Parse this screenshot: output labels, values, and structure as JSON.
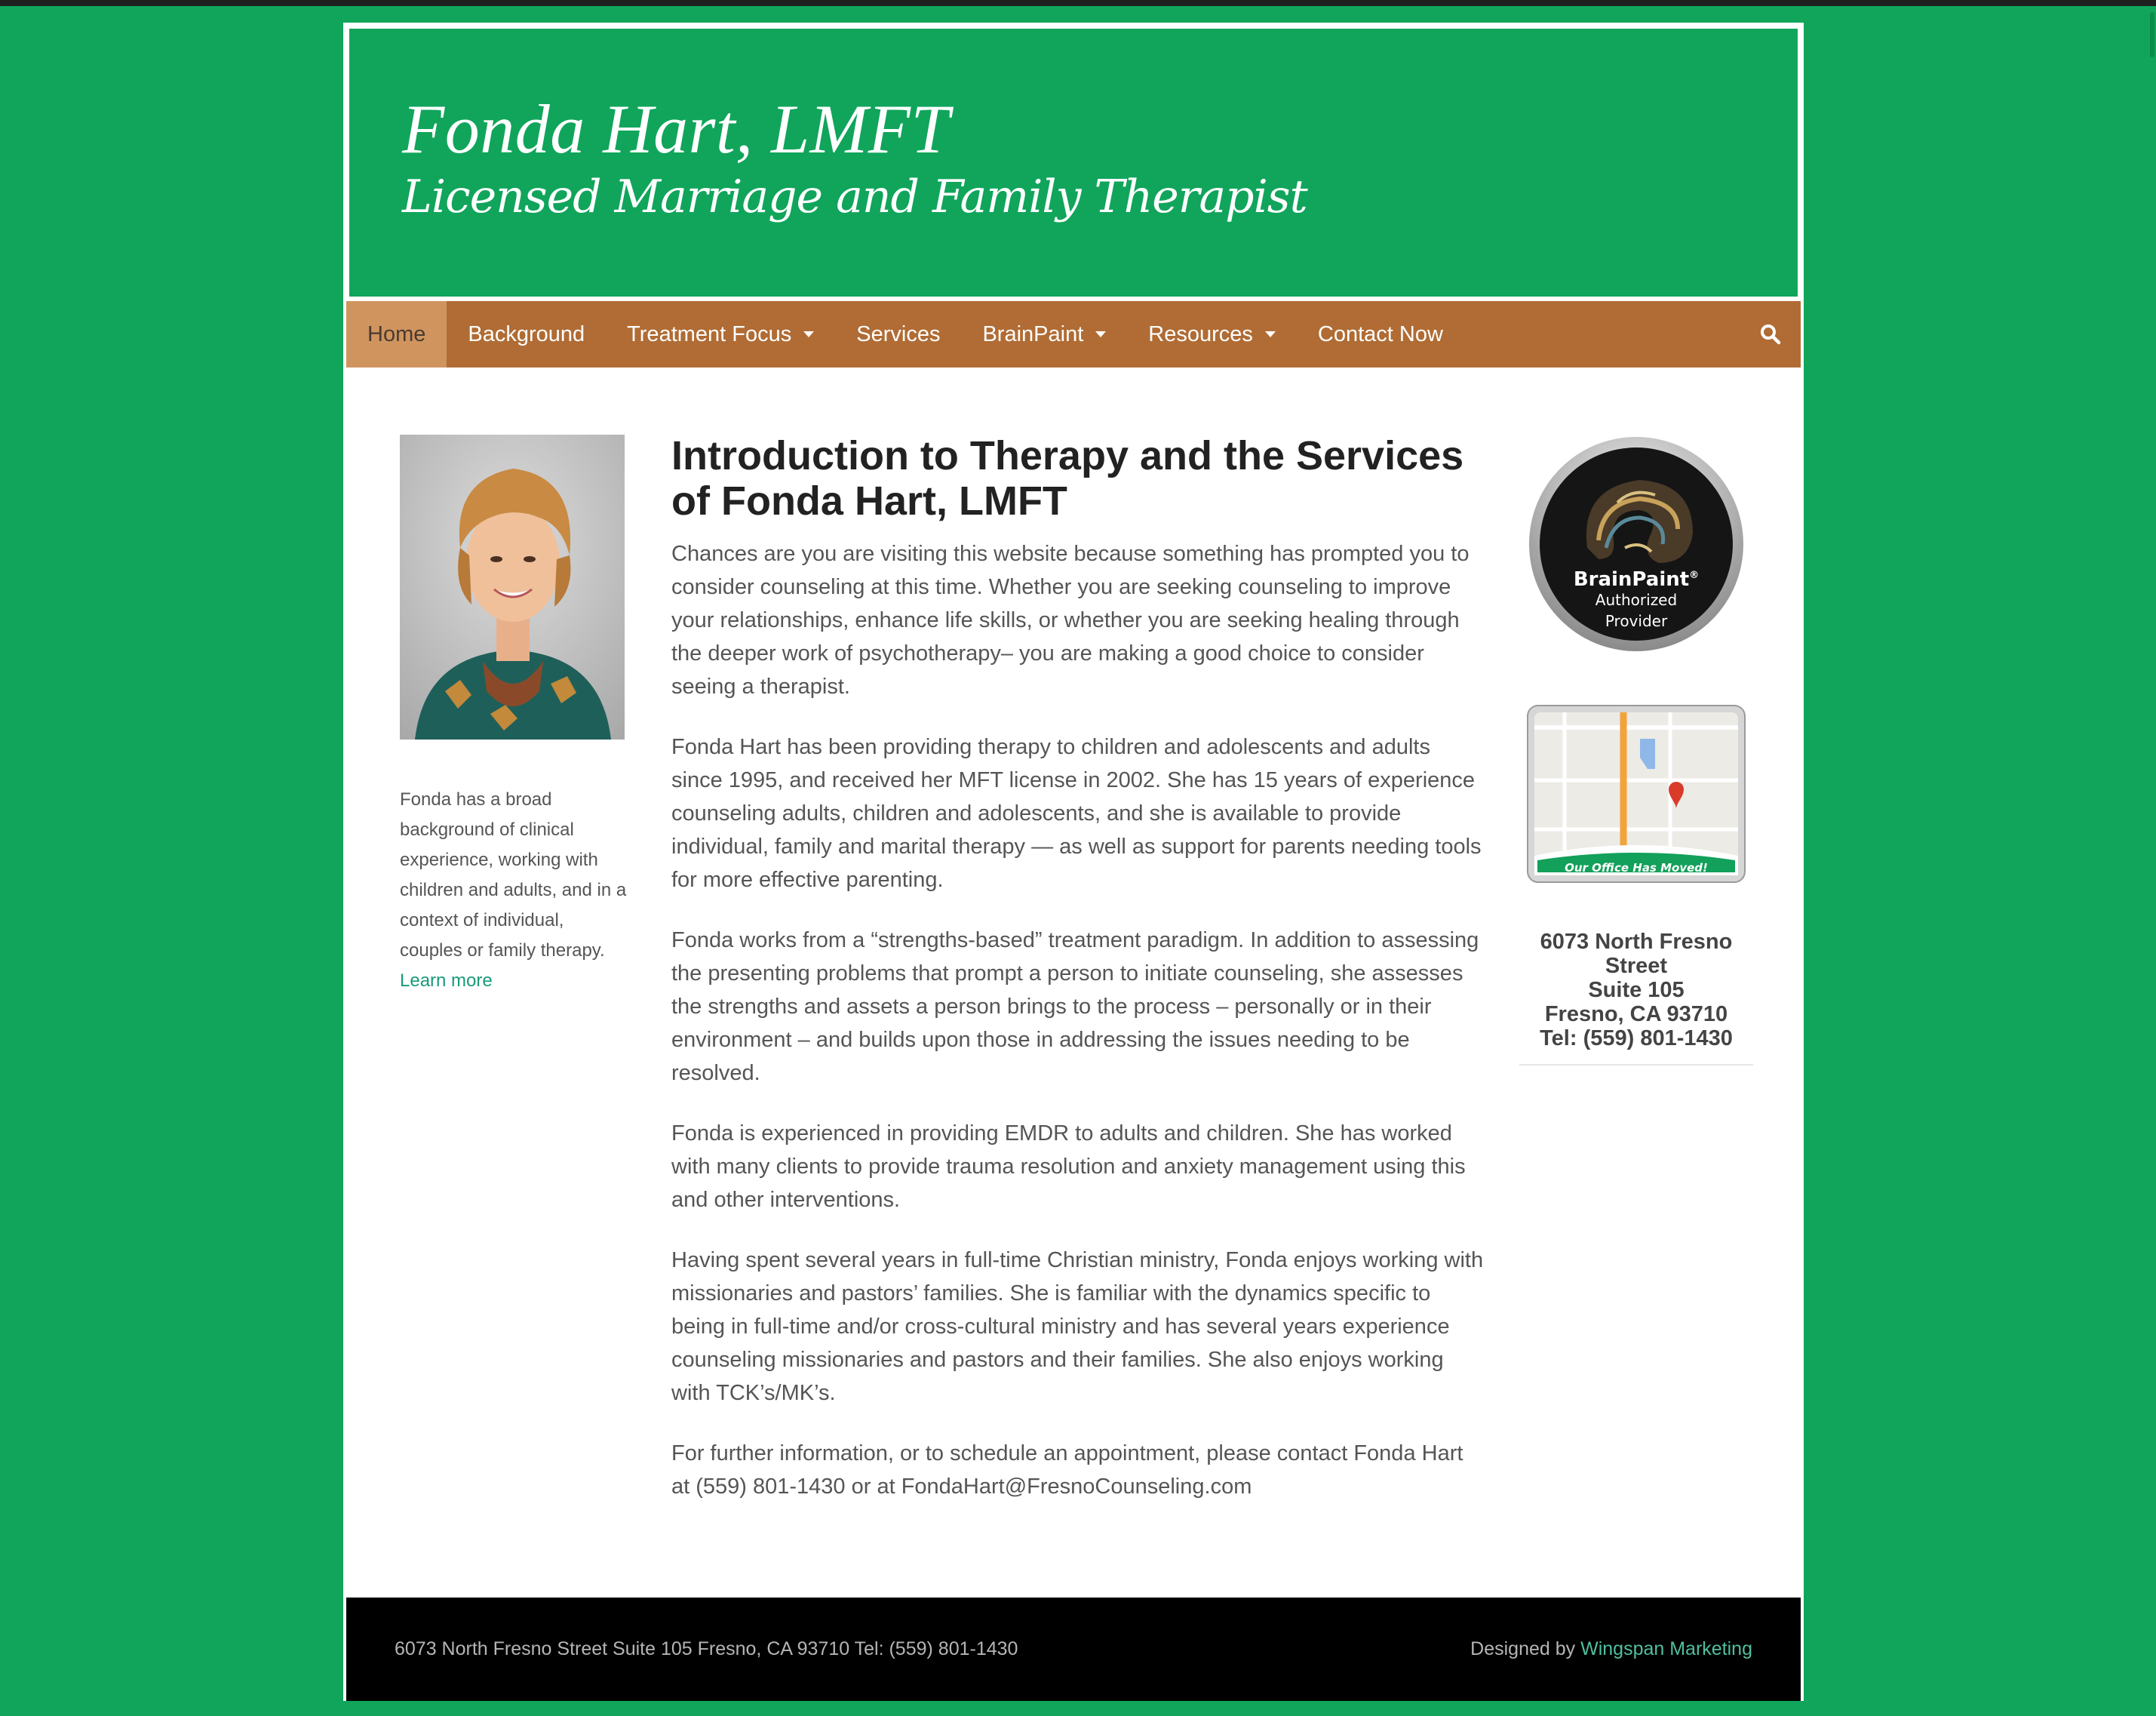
{
  "header": {
    "title": "Fonda Hart, LMFT",
    "tagline": "Licensed Marriage and Family Therapist"
  },
  "nav": {
    "items": [
      {
        "label": "Home",
        "active": true,
        "has_dropdown": false
      },
      {
        "label": "Background",
        "has_dropdown": false
      },
      {
        "label": "Treatment Focus",
        "has_dropdown": true
      },
      {
        "label": "Services",
        "has_dropdown": false
      },
      {
        "label": "BrainPaint",
        "has_dropdown": true
      },
      {
        "label": "Resources",
        "has_dropdown": true
      },
      {
        "label": "Contact Now",
        "has_dropdown": false
      }
    ],
    "search_icon": "search-icon"
  },
  "sidebar_left": {
    "bio_text": "Fonda has a broad background of clinical experience, working with children and adults, and in a context of individual, couples or family therapy.",
    "learn_more_label": "Learn more"
  },
  "main": {
    "heading": "Introduction to Therapy and the Services of Fonda Hart, LMFT",
    "paragraphs": [
      "Chances are you are visiting this website because something has prompted you to consider counseling at this time. Whether you are seeking counseling to improve your relationships, enhance life skills, or whether you are seeking healing through the deeper work of psychotherapy– you are making a good choice to consider seeing a therapist.",
      "Fonda Hart has been providing therapy to children and adolescents and adults since 1995, and received her MFT license in 2002. She has 15 years of experience counseling adults, children and adolescents, and she is available to provide individual, family and marital therapy — as well as support for parents needing tools for more effective parenting.",
      "Fonda works from a “strengths-based” treatment paradigm. In addition to assessing the presenting problems that prompt a person to initiate counseling, she assesses the strengths and assets a person brings to the process – personally or in their environment – and builds upon those in addressing the issues needing to be resolved.",
      "Fonda is experienced in providing EMDR to adults and children. She has worked with many clients to provide trauma resolution and anxiety management using this and other interventions.",
      "Having spent several years in full-time Christian ministry, Fonda enjoys working with missionaries and pastors’ families. She is familiar with the dynamics specific to being in full-time and/or cross-cultural ministry and has several years experience counseling missionaries and pastors and their families. She also enjoys working with TCK’s/MK’s.",
      "For further information, or to schedule an appointment, please contact Fonda Hart at (559) 801-1430 or at FondaHart@FresnoCounseling.com"
    ]
  },
  "sidebar_right": {
    "badge": {
      "line1": "BrainPaint",
      "reg": "®",
      "line2": "Authorized",
      "line3": "Provider"
    },
    "map": {
      "banner": "Our Office Has Moved!"
    },
    "address": {
      "line1": "6073 North Fresno",
      "line2": "Street",
      "line3": "Suite 105",
      "line4": "Fresno, CA 93710",
      "line5": "Tel: (559) 801-1430"
    }
  },
  "footer": {
    "address": "6073 North Fresno Street Suite 105 Fresno, CA 93710 Tel: (559) 801-1430",
    "designed_by": "Designed by",
    "designer_link": "Wingspan Marketing"
  },
  "colors": {
    "background": "#10a55b",
    "nav": "#b06c34",
    "nav_active": "#d0955f",
    "footer": "#000000",
    "link": "#1a9a7a"
  }
}
